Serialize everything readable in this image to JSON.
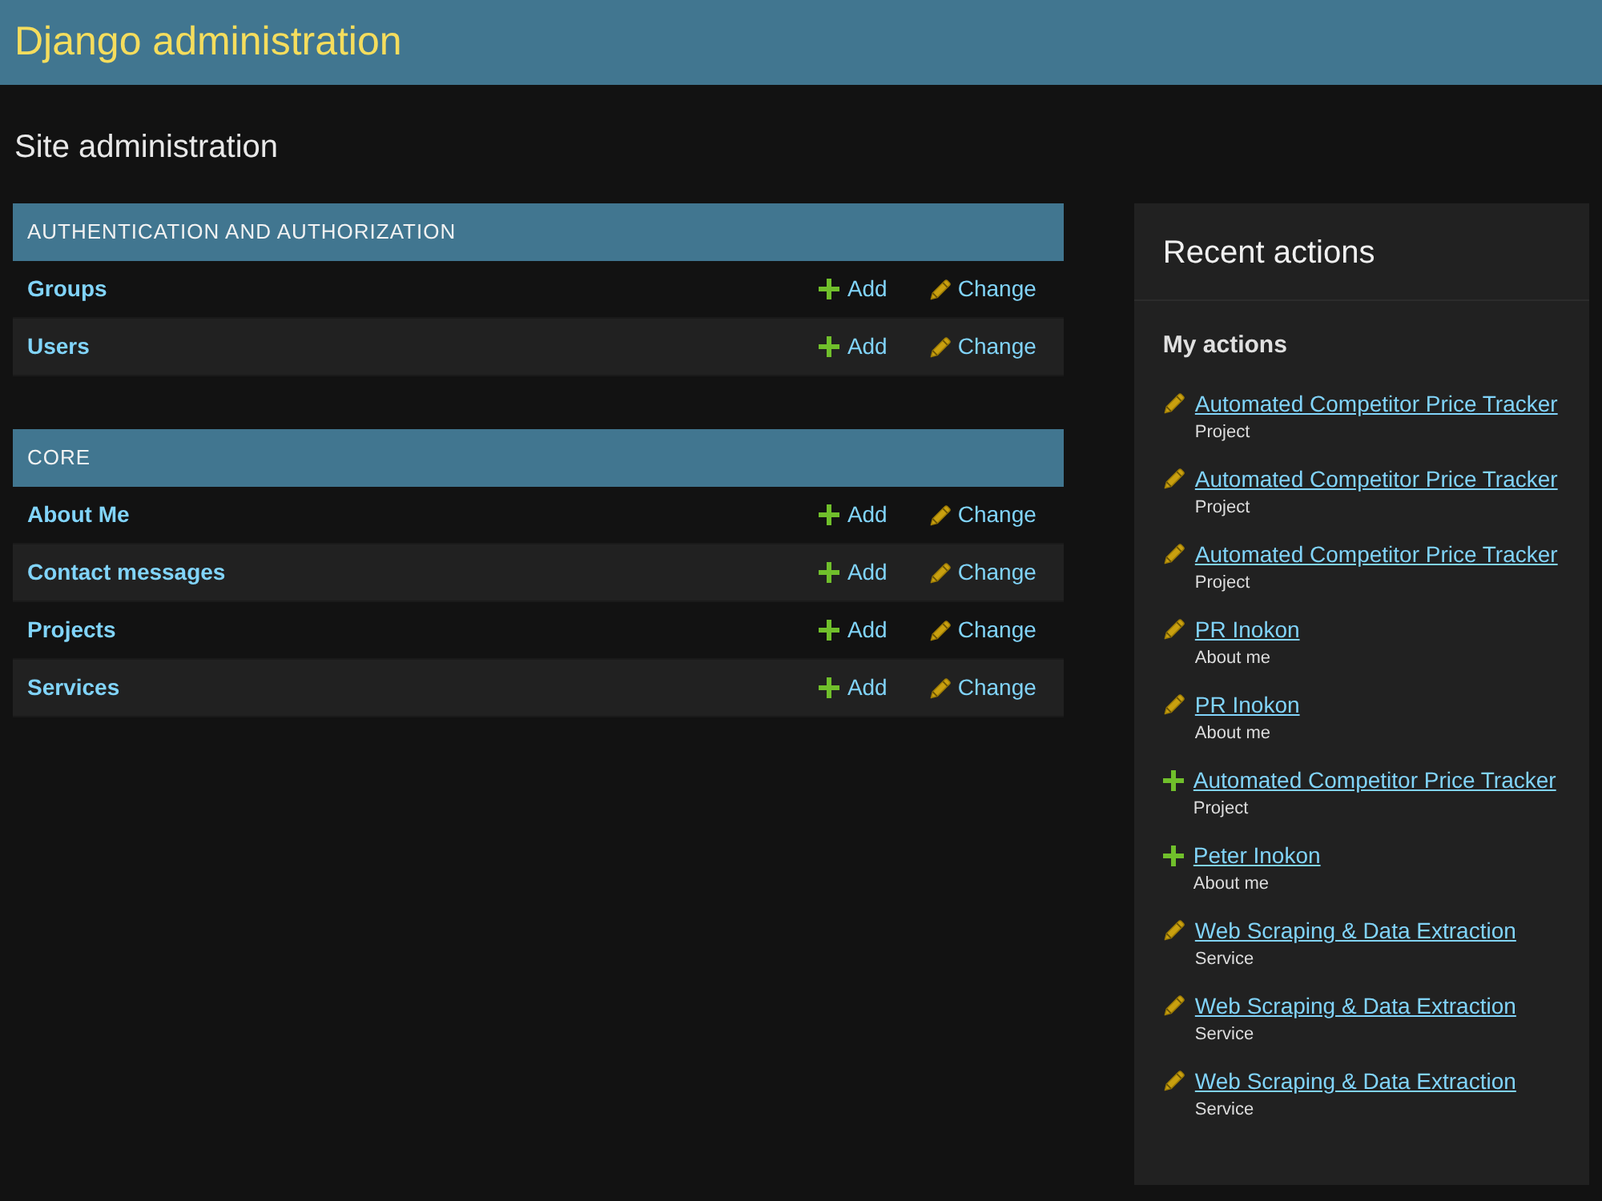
{
  "header": {
    "title": "Django administration"
  },
  "page_title": "Site administration",
  "modules": [
    {
      "caption": "AUTHENTICATION AND AUTHORIZATION",
      "models": [
        {
          "name": "Groups",
          "add": "Add",
          "change": "Change"
        },
        {
          "name": "Users",
          "add": "Add",
          "change": "Change"
        }
      ]
    },
    {
      "caption": "CORE",
      "models": [
        {
          "name": "About Me",
          "add": "Add",
          "change": "Change"
        },
        {
          "name": "Contact messages",
          "add": "Add",
          "change": "Change"
        },
        {
          "name": "Projects",
          "add": "Add",
          "change": "Change"
        },
        {
          "name": "Services",
          "add": "Add",
          "change": "Change"
        }
      ]
    }
  ],
  "recent_actions": {
    "title": "Recent actions",
    "subtitle": "My actions",
    "items": [
      {
        "kind": "change",
        "name": "Automated Competitor Price Tracker",
        "type": "Project"
      },
      {
        "kind": "change",
        "name": "Automated Competitor Price Tracker",
        "type": "Project"
      },
      {
        "kind": "change",
        "name": "Automated Competitor Price Tracker",
        "type": "Project"
      },
      {
        "kind": "change",
        "name": "PR Inokon",
        "type": "About me"
      },
      {
        "kind": "change",
        "name": "PR Inokon",
        "type": "About me"
      },
      {
        "kind": "add",
        "name": "Automated Competitor Price Tracker",
        "type": "Project"
      },
      {
        "kind": "add",
        "name": "Peter Inokon",
        "type": "About me"
      },
      {
        "kind": "change",
        "name": "Web Scraping & Data Extraction",
        "type": "Service"
      },
      {
        "kind": "change",
        "name": "Web Scraping & Data Extraction",
        "type": "Service"
      },
      {
        "kind": "change",
        "name": "Web Scraping & Data Extraction",
        "type": "Service"
      }
    ]
  }
}
